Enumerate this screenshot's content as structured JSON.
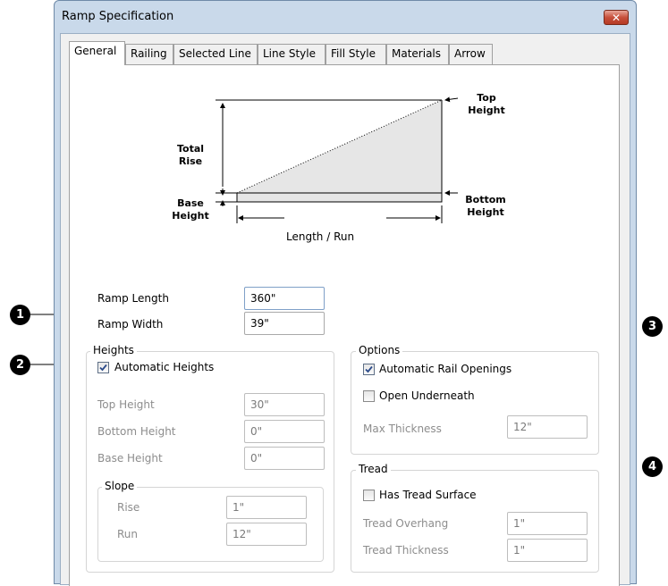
{
  "window": {
    "title": "Ramp Specification"
  },
  "tabs": [
    {
      "label": "General",
      "active": true
    },
    {
      "label": "Railing"
    },
    {
      "label": "Selected Line"
    },
    {
      "label": "Line Style"
    },
    {
      "label": "Fill Style"
    },
    {
      "label": "Materials"
    },
    {
      "label": "Arrow"
    }
  ],
  "diagram": {
    "total_rise": "Total\nRise",
    "base_height": "Base\nHeight",
    "top_height": "Top\nHeight",
    "bottom_height": "Bottom\nHeight",
    "length_run": "Length / Run"
  },
  "fields": {
    "ramp_length": {
      "label": "Ramp Length",
      "value": "360\""
    },
    "ramp_width": {
      "label": "Ramp Width",
      "value": "39\""
    }
  },
  "heights": {
    "title": "Heights",
    "automatic": {
      "label": "Automatic Heights",
      "checked": true
    },
    "top_height": {
      "label": "Top Height",
      "value": "30\""
    },
    "bottom_height": {
      "label": "Bottom Height",
      "value": "0\""
    },
    "base_height": {
      "label": "Base Height",
      "value": "0\""
    },
    "slope": {
      "title": "Slope",
      "rise": {
        "label": "Rise",
        "value": "1\""
      },
      "run": {
        "label": "Run",
        "value": "12\""
      }
    }
  },
  "options": {
    "title": "Options",
    "auto_rail_openings": {
      "label": "Automatic Rail Openings",
      "checked": true
    },
    "open_underneath": {
      "label": "Open Underneath",
      "checked": false
    },
    "max_thickness": {
      "label": "Max Thickness",
      "value": "12\""
    }
  },
  "tread": {
    "title": "Tread",
    "has_surface": {
      "label": "Has Tread Surface",
      "checked": false
    },
    "overhang": {
      "label": "Tread Overhang",
      "value": "1\""
    },
    "thickness": {
      "label": "Tread Thickness",
      "value": "1\""
    }
  },
  "callouts": [
    "1",
    "2",
    "3",
    "4"
  ]
}
